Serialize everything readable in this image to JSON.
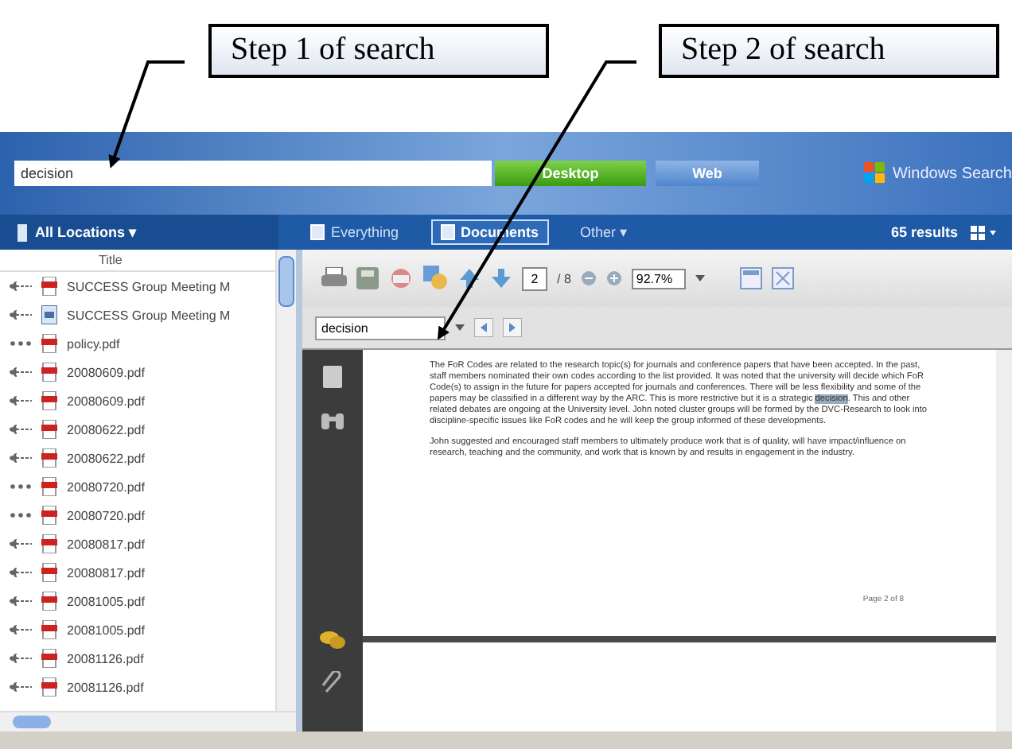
{
  "callouts": [
    {
      "label": "Step 1 of search"
    },
    {
      "label": "Step 2 of search"
    }
  ],
  "search": {
    "value": "decision",
    "buttons": [
      {
        "label": "Desktop",
        "selected": true
      },
      {
        "label": "Web",
        "selected": false
      }
    ],
    "brand": "Windows Search"
  },
  "filter_bar": {
    "location": "All Locations",
    "location_caret": "▾",
    "tabs": [
      {
        "label": "Everything",
        "kind": "icon",
        "selected": false
      },
      {
        "label": "Documents",
        "kind": "icon",
        "selected": true
      },
      {
        "label": "Other",
        "kind": "menu",
        "caret": "▾",
        "selected": false
      }
    ],
    "results": "65 results"
  },
  "file_list": {
    "column": "Title",
    "rows": [
      {
        "name": "SUCCESS Group Meeting M",
        "kind": "pdf",
        "linked": true
      },
      {
        "name": "SUCCESS Group Meeting M",
        "kind": "doc",
        "linked": true
      },
      {
        "name": "policy.pdf",
        "kind": "pdf",
        "linked": false
      },
      {
        "name": "20080609.pdf",
        "kind": "pdf",
        "linked": true
      },
      {
        "name": "20080609.pdf",
        "kind": "pdf",
        "linked": true
      },
      {
        "name": "20080622.pdf",
        "kind": "pdf",
        "linked": true
      },
      {
        "name": "20080622.pdf",
        "kind": "pdf",
        "linked": true
      },
      {
        "name": "20080720.pdf",
        "kind": "pdf",
        "linked": false
      },
      {
        "name": "20080720.pdf",
        "kind": "pdf",
        "linked": false
      },
      {
        "name": "20080817.pdf",
        "kind": "pdf",
        "linked": true
      },
      {
        "name": "20080817.pdf",
        "kind": "pdf",
        "linked": true
      },
      {
        "name": "20081005.pdf",
        "kind": "pdf",
        "linked": true
      },
      {
        "name": "20081005.pdf",
        "kind": "pdf",
        "linked": true
      },
      {
        "name": "20081126.pdf",
        "kind": "pdf",
        "linked": true
      },
      {
        "name": "20081126.pdf",
        "kind": "pdf",
        "linked": true
      }
    ]
  },
  "viewer": {
    "page": "2",
    "page_total": "/ 8",
    "zoom": "92.7%",
    "find": "decision",
    "paragraphs": [
      {
        "before": "The FoR Codes are related to the research topic(s) for journals and conference papers that have been accepted. In the past, staff members nominated their own codes according to the list provided. It was noted that the university will decide which FoR Code(s) to assign in the future for papers accepted for journals and conferences. There will be less flexibility and some of the papers may be classified in a different way by the ARC. This is more restrictive but it is a strategic ",
        "match": "decision",
        "after": ". This and other related debates are ongoing at the University level. John noted cluster groups will be formed by the DVC-Research to look into discipline-specific issues like FoR codes and he will keep the group informed of these developments."
      },
      {
        "before": "John suggested and encouraged staff members to ultimately produce work that is of quality, will have impact/influence on research, teaching and the community, and work that is known by and results in engagement in the industry."
      }
    ],
    "page_footer": "Page 2 of 8"
  }
}
